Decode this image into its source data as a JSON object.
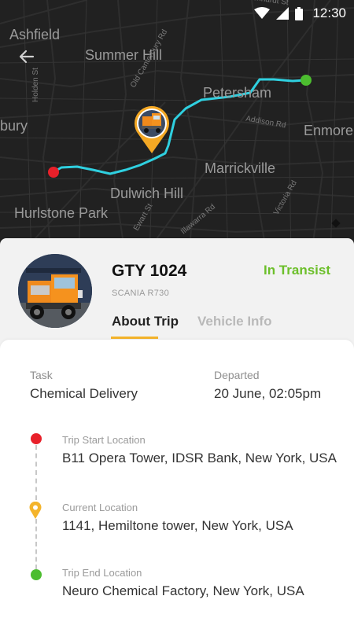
{
  "status_bar": {
    "time": "12:30"
  },
  "map": {
    "labels": {
      "top_street": "Leichhardt St",
      "ashfield": "Ashfield",
      "summer_hill": "Summer Hill",
      "old_canterbury": "Old Canterbury Rd",
      "holden": "Holden St",
      "petersham": "Petersham",
      "bury": "bury",
      "addison": "Addison Rd",
      "enmore": "Enmore",
      "marrickville": "Marrickville",
      "dulwich_hill": "Dulwich Hill",
      "hurlstone_park": "Hurlstone Park",
      "ewart": "Ewart St",
      "victoria": "Victoria Rd",
      "illawarra": "Illawarra Rd",
      "canterbury": "Canterbury Rd"
    },
    "route": {
      "start_color": "#e8202a",
      "end_color": "#4cbd2f",
      "line_color": "#2fd0e0"
    }
  },
  "vehicle": {
    "plate": "GTY 1024",
    "model": "SCANIA R730",
    "status": "In Transist",
    "status_color": "#6cbf2a"
  },
  "tabs": [
    {
      "label": "About Trip",
      "active": true
    },
    {
      "label": "Vehicle Info",
      "active": false
    }
  ],
  "trip": {
    "task_label": "Task",
    "task_value": "Chemical Delivery",
    "departed_label": "Departed",
    "departed_value": "20 June, 02:05pm",
    "stops": [
      {
        "label": "Trip Start Location",
        "value": "B11 Opera Tower, IDSR Bank, New York, USA",
        "color": "#e8202a"
      },
      {
        "label": "Current Location",
        "value": "1141, Hemiltone tower, New York, USA",
        "color": "#f4b42b"
      },
      {
        "label": "Trip End Location",
        "value": "Neuro Chemical Factory, New York, USA",
        "color": "#4cbd2f"
      }
    ]
  }
}
